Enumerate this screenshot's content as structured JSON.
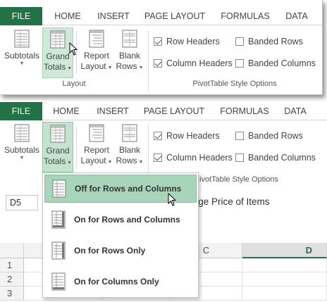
{
  "ribbon_tabs": [
    "FILE",
    "HOME",
    "INSERT",
    "PAGE LAYOUT",
    "FORMULAS",
    "DATA"
  ],
  "layout_group": {
    "label": "Layout",
    "buttons": [
      {
        "line1": "Subtotals",
        "line2": "",
        "icon": "subtotals-icon"
      },
      {
        "line1": "Grand",
        "line2": "Totals",
        "icon": "grand-totals-icon"
      },
      {
        "line1": "Report",
        "line2": "Layout",
        "icon": "report-layout-icon"
      },
      {
        "line1": "Blank",
        "line2": "Rows",
        "icon": "blank-rows-icon"
      }
    ]
  },
  "style_options_group": {
    "label": "PivotTable Style Options",
    "label_partial": "ivotTable Style Options",
    "checkboxes": [
      {
        "label": "Row Headers",
        "checked": true
      },
      {
        "label": "Banded Rows",
        "checked": false
      },
      {
        "label": "Column Headers",
        "checked": true
      },
      {
        "label": "Banded Columns",
        "checked": false
      }
    ]
  },
  "grand_totals_menu": {
    "items": [
      {
        "label": "Off for Rows and Columns",
        "icon": "grand-totals-off-icon",
        "active": true
      },
      {
        "label": "On for Rows and Columns",
        "icon": "grand-totals-on-icon",
        "active": false
      },
      {
        "label": "On for Rows Only",
        "icon": "grand-totals-rows-icon",
        "active": false
      },
      {
        "label": "On for Columns Only",
        "icon": "grand-totals-columns-icon",
        "active": false
      }
    ]
  },
  "name_box": {
    "value": "D5"
  },
  "formula_bar": {
    "value": "verage Price of Items"
  },
  "sheet": {
    "columns": [
      "C",
      "D"
    ],
    "rows": [
      "1",
      "2",
      "3"
    ]
  },
  "colors": {
    "accent": "#217346",
    "hover": "#cfe8d8",
    "menu_active": "#a8d5b9"
  }
}
